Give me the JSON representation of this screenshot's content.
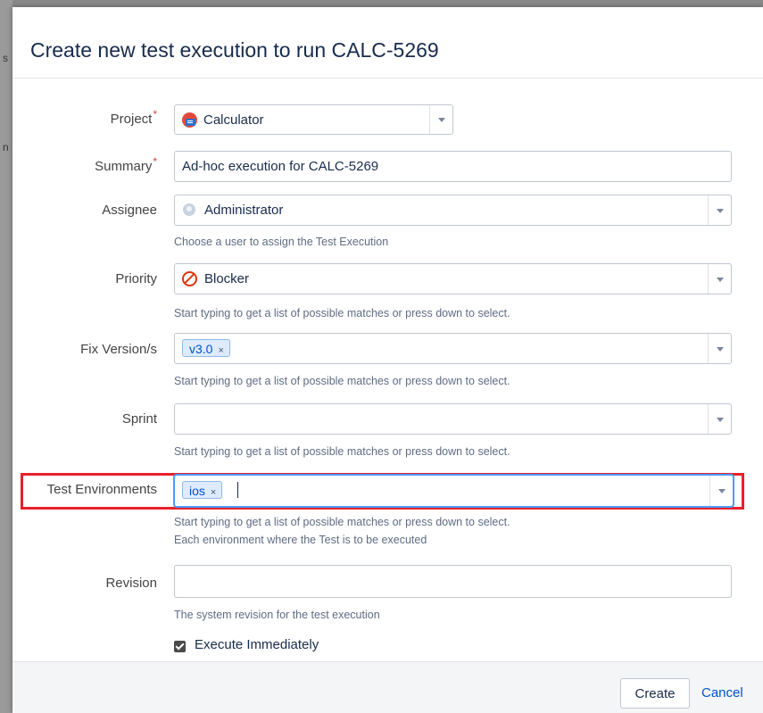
{
  "dialog": {
    "title": "Create new test execution to run CALC-5269"
  },
  "fields": {
    "project": {
      "label": "Project",
      "required_mark": "*",
      "value": "Calculator",
      "icon": "calculator-project-icon"
    },
    "summary": {
      "label": "Summary",
      "required_mark": "*",
      "value": "Ad-hoc execution for CALC-5269"
    },
    "assignee": {
      "label": "Assignee",
      "value": "Administrator",
      "icon": "user-avatar-icon",
      "hint": "Choose a user to assign the Test Execution"
    },
    "priority": {
      "label": "Priority",
      "value": "Blocker",
      "icon": "blocker-icon",
      "hint": "Start typing to get a list of possible matches or press down to select."
    },
    "fix_version": {
      "label": "Fix Version/s",
      "tag": "v3.0",
      "tag_remove": "×",
      "hint": "Start typing to get a list of possible matches or press down to select."
    },
    "sprint": {
      "label": "Sprint",
      "value": "",
      "hint": "Start typing to get a list of possible matches or press down to select."
    },
    "test_environments": {
      "label": "Test Environments",
      "tag": "ios",
      "tag_remove": "×",
      "hint1": "Start typing to get a list of possible matches or press down to select.",
      "hint2": "Each environment where the Test is to be executed"
    },
    "revision": {
      "label": "Revision",
      "value": "",
      "hint": "The system revision for the test execution"
    }
  },
  "execute_immediately": {
    "label": "Execute Immediately",
    "checked": true
  },
  "footer": {
    "create_label": "Create",
    "cancel_label": "Cancel"
  },
  "colors": {
    "highlight": "#e8202a",
    "link": "#0052cc",
    "required": "#d04437"
  }
}
